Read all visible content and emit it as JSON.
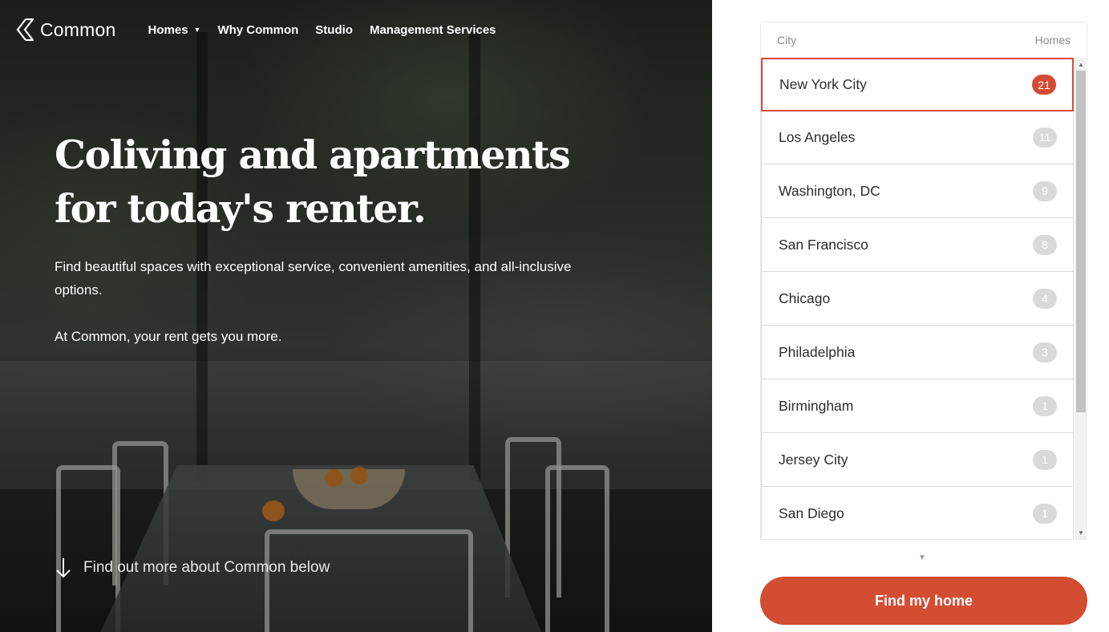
{
  "brand": {
    "name": "Common",
    "accent": "#d44b33"
  },
  "nav": {
    "items": [
      {
        "label": "Homes",
        "has_dropdown": true
      },
      {
        "label": "Why Common"
      },
      {
        "label": "Studio"
      },
      {
        "label": "Management Services"
      }
    ],
    "dropdown_icon": "caret-down-icon"
  },
  "hero": {
    "headline_line1": "Coliving and apartments",
    "headline_line2": "for today's renter.",
    "paragraph1": "Find beautiful spaces with exceptional service, convenient amenities, and all-inclusive options.",
    "paragraph2": "At Common, your rent gets you more.",
    "learn_more": "Find out more about Common below",
    "learn_more_icon": "arrow-down-icon"
  },
  "city_selector": {
    "col_city": "City",
    "col_homes": "Homes",
    "selected": "New York City",
    "cities": [
      {
        "name": "New York City",
        "homes": "21"
      },
      {
        "name": "Los Angeles",
        "homes": "11"
      },
      {
        "name": "Washington, DC",
        "homes": "9"
      },
      {
        "name": "San Francisco",
        "homes": "8"
      },
      {
        "name": "Chicago",
        "homes": "4"
      },
      {
        "name": "Philadelphia",
        "homes": "3"
      },
      {
        "name": "Birmingham",
        "homes": "1"
      },
      {
        "name": "Jersey City",
        "homes": "1"
      },
      {
        "name": "San Diego",
        "homes": "1"
      }
    ],
    "more_icon": "chevron-down-icon"
  },
  "cta": {
    "label": "Find my home",
    "color": "#d34d33"
  }
}
